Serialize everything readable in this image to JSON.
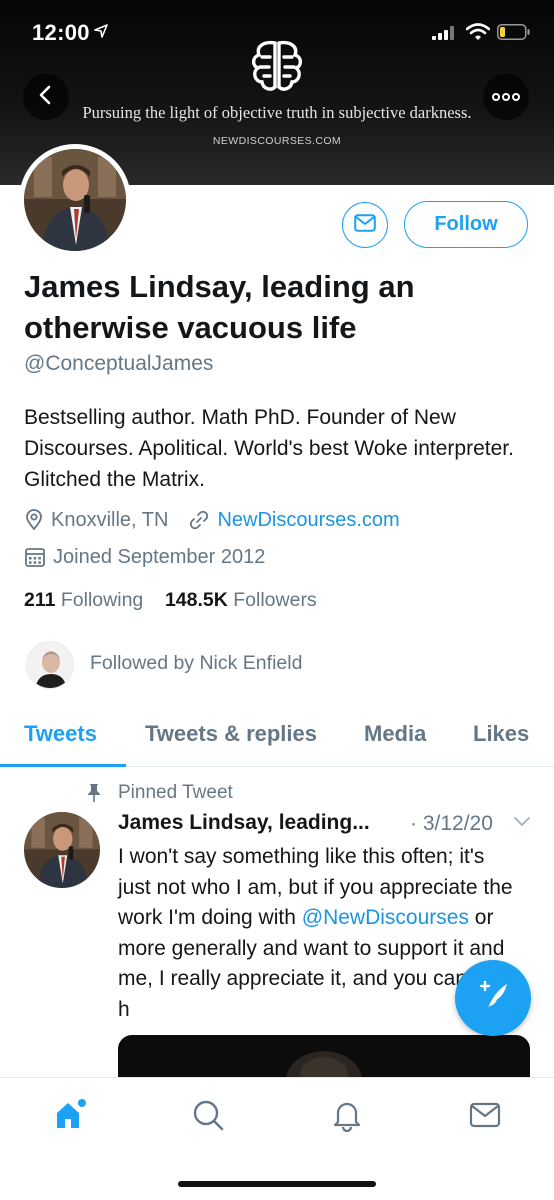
{
  "status_bar": {
    "time": "12:00"
  },
  "banner": {
    "tagline": "Pursuing the light of objective truth in subjective darkness.",
    "site": "NEWDISCOURSES.COM"
  },
  "profile": {
    "display_name": "James Lindsay, leading an otherwise vacuous life",
    "handle": "@ConceptualJames",
    "bio": "Bestselling author. Math PhD. Founder of New Discourses. Apolitical. World's best Woke interpreter. Glitched the Matrix.",
    "location": "Knoxville, TN",
    "website": "NewDiscourses.com",
    "joined": "Joined September 2012",
    "following_count": "211",
    "following_label": "Following",
    "followers_count": "148.5K",
    "followers_label": "Followers",
    "followed_by": "Followed by Nick Enfield"
  },
  "actions": {
    "follow_label": "Follow"
  },
  "tabs": [
    {
      "label": "Tweets",
      "active": true
    },
    {
      "label": "Tweets & replies",
      "active": false
    },
    {
      "label": "Media",
      "active": false
    },
    {
      "label": "Likes",
      "active": false
    }
  ],
  "pinned_tweet": {
    "pinned_label": "Pinned Tweet",
    "author": "James Lindsay, leading...",
    "date": "· 3/12/20",
    "text_before": "I won't say something like this often; it's just not who I am, but if you appreciate the work I'm doing with ",
    "mention": "@NewDiscourses",
    "text_after": " or more generally and want to support it and me, I really appreciate it, and you can do it h"
  },
  "colors": {
    "accent": "#1da1f2",
    "link": "#1b95e0",
    "secondary_text": "#657786",
    "primary_text": "#14171a"
  },
  "icons": {
    "status": [
      "location-arrow-icon",
      "signal-icon",
      "wifi-icon",
      "battery-icon"
    ],
    "header": [
      "back-arrow-icon",
      "more-icon",
      "brain-logo-icon"
    ],
    "meta": [
      "location-pin-icon",
      "link-icon",
      "calendar-icon"
    ],
    "nav": [
      "home-icon",
      "search-icon",
      "notifications-bell-icon",
      "messages-envelope-icon"
    ],
    "fab": "compose-tweet-icon"
  }
}
